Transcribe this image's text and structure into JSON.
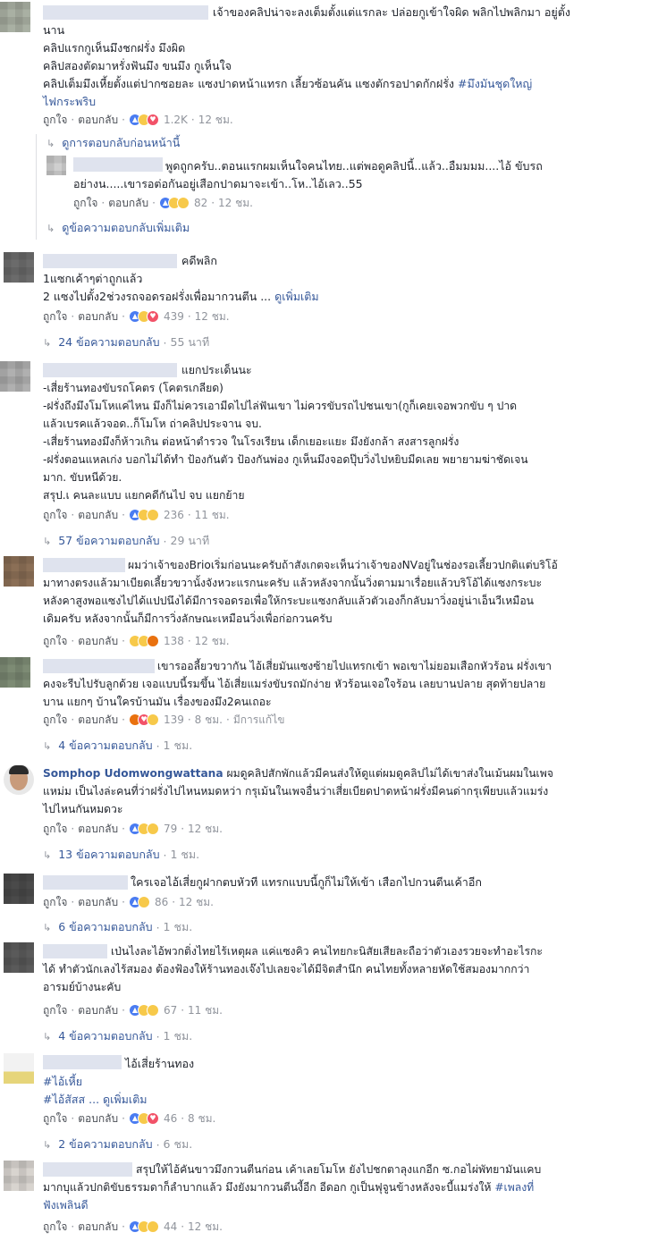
{
  "ui": {
    "like": "ถูกใจ",
    "reply": "ตอบกลับ",
    "dot": "·",
    "see_more": "ดูเพิ่มเติม",
    "prev_replies": "ดูการตอบกลับก่อนหน้านี้",
    "more_replies": "ดูข้อความตอบกลับเพิ่มเติม",
    "edited": "มีการแก้ไข"
  },
  "comments": [
    {
      "name": "",
      "lines": [
        "เจ้าของคลิปน่าจะลงเต็มตั้งแต่แรกละ ปล่อยกูเข้าใจผิด พลิกไปพลิกมา อยู่ตั้ง",
        "นาน",
        "คลิปแรกกูเห็นมึงชกฝรั่ง มึงผิด",
        "คลิปสองตัดมาหรั่งฟันมึง ขนมึง กูเห็นใจ",
        "คลิปเต็มมึงเหี้ยตั้งแต่ปากซอยละ แซงปาดหน้าแทรก เลี้ยวซ้อนคัน แซงตักรอปาดกักฝรั่ง",
        "ไฟกระพริบ"
      ],
      "hashtag": "#มึงมันชุดใหญ่",
      "reactions": "1.2K",
      "time": "12 ชม.",
      "replies_label": ""
    },
    {
      "name": "",
      "lines": [
        "พูดถูกครับ..ตอนแรกผมเห็นใจคนไทย..แต่พอดูคลิปนี้..แล้ว..อืมมมม....ไอ้ ขับรถ",
        "อย่างน.....เขารอต่อกันอยู่เสือกปาดมาจะเข้า..โห..ไอ้เลว..55"
      ],
      "reactions": "82",
      "time": "12 ชม."
    },
    {
      "name": "คดีพลิก",
      "lines": [
        "1แซกเค้าๆต่าถูกแล้ว",
        "2 แซงไปตั้ง2ช่วงรถจอดรอฝรั่งเพื่อมากวนตีน ..."
      ],
      "reactions": "439",
      "time": "12 ชม.",
      "replies_label": "24 ข้อความตอบกลับ",
      "replies_time": "55 นาที"
    },
    {
      "name": "แยกประเด็นนะ",
      "lines": [
        "-เสี่ยร้านทองขับรถโคตร (โคตรเกลียด)",
        "-ฝรั่งถึงมึงโมโหแค่ไหน มึงก็ไม่ควรเอามีดไปไล่ฟันเขา ไม่ควรขับรถไปชนเขา(กูก็เคยเจอพวกขับ ๆ ปาด",
        "แล้วเบรคแล้วจอด..ก็โมโห ถ่าคลิปประจาน จบ.",
        "-เสี่ยร้านทองมึงก็ห้าวเกิน ต่อหน้าตำรวจ ในโรงเรียน เด็กเยอะแยะ มึงยังกล้า สงสารลูกฝรั่ง",
        "-ฝรั่งตอนแหลเก่ง บอกไม่ได้ทำ ป้องกันตัว ป้องกันพ่อง กูเห็นมึงจอดปุ๊บวิ่งไปหยิบมีดเลย พยายามฆ่าชัดเจน",
        "มาก. ขับหนีด้วย.",
        "สรุป.เ คนละแบบ แยกคดีกันไป จบ แยกย้าย"
      ],
      "reactions": "236",
      "time": "11 ชม.",
      "replies_label": "57 ข้อความตอบกลับ",
      "replies_time": "29 นาที"
    },
    {
      "name": "",
      "lines": [
        "ผมว่าเจ้าของBrioเริ่มก่อนนะครับถ้าสังเกตจะเห็นว่าเจ้าของNVอยู่ในช่องรอเลี้ยวปกติแต่บริโอ้",
        "มาทางตรงแล้วมาเบียดเลี้ยวขวานั้งจังหวะแรกนะครับ แล้วหลังจากนั้นวิ่งตามมาเรื่อยแล้วบริโอ้ได้แซงกระบะ",
        "หลังคาสูงพอแซงไปได้แปปนึงได้มีการจอดรอเพื่อให้กระบะแซงกลับแล้วตัวเองก็กลับมาวิ่งอยู่น่าเอ็นวีเหมือน",
        "เดิมครับ หลังจากนั้นก็มีการวิ่งลักษณะเหมือนวิ่งเพื่อก่อกวนครับ"
      ],
      "reactions": "138",
      "time": "12 ชม."
    },
    {
      "name": "",
      "lines": [
        "เขารออลี้ยวขวากัน ไอ้เสี่ยมันแซงซ้ายไปแทรกเข้า พอเขาไม่ยอมเสือกหัวร้อน ฝรั่งเขา",
        "คงจะรีบไปรับลูกด้วย เจอแบบนี้รมขึ้น ไอ้เสี่ยแมร่งขับรถมักง่าย หัวร้อนเจอใจร้อน เลยบานปลาย สุดท้ายปลาย",
        "บาน แยกๆ บ้านใครบ้านมัน เรื่องของมึง2คนเถอะ"
      ],
      "reactions": "139",
      "time": "8 ชม.",
      "replies_label": "4 ข้อความตอบกลับ",
      "replies_time": "1 ชม."
    },
    {
      "name": "Somphop Udomwongwattana",
      "lines": [
        "ผมดูคลิปสักพักแล้วมีคนส่งให้ดูแต่ผมดูคลิปไม่ได้เขาส่งในเม้นผมในเพจ",
        "แหม่ม เป็นไงล่ะคนที่ว่าฝรั่งไปไหนหมดหว่า กรุเม้นในเพจอื่นว่าเสี่ยเบียดปาดหน้าฝรั่งมีคนด่ากรุเพียบแล้วแมร่ง",
        "ไปไหนกันหมดวะ"
      ],
      "reactions": "79",
      "time": "12 ชม.",
      "replies_label": "13 ข้อความตอบกลับ",
      "replies_time": "1 ชม."
    },
    {
      "name": "",
      "lines": [
        "ใครเจอไอ้เสี่ยกูฝากตบหัวที แทรกแบบนี้กูก็ไม่ให้เข้า เสือกไปกวนตีนเค้าอีก"
      ],
      "reactions": "86",
      "time": "12 ชม.",
      "replies_label": "6 ข้อความตอบกลับ",
      "replies_time": "1 ชม."
    },
    {
      "name": "",
      "lines": [
        "เป่นไงละไอ้พวกติ่งไทยไร้เหตุผล แค่แซงคิว คนไทยกะนิสัยเสียละถือว่าตัวเองรวยจะทำอะไรกะ",
        "ได้ ทำตัวนักเลงไร้สมอง ต้องฟ้องให้ร้านทองเจ๊งไปเลยจะได้มีจิตสำนึก คนไทยทั้งหลายหัดใช้สมองมากกว่า",
        "อารมย์บ้างนะคับ"
      ],
      "reactions": "67",
      "time": "11 ชม.",
      "replies_label": "4 ข้อความตอบกลับ",
      "replies_time": "1 ชม."
    },
    {
      "name": "ไอ้เสี่ยร้านทอง",
      "lines": [
        "#ไอ้เหี้ย",
        "#ไอ้สัสส ..."
      ],
      "reactions": "46",
      "time": "8 ชม.",
      "replies_label": "2 ข้อความตอบกลับ",
      "replies_time": "6 ชม."
    },
    {
      "name": "",
      "lines": [
        "สรุปให้ไอ้คันขาวมึงกวนตีนก่อน เค้าเลยโมโห ยังไปชกตาลุงแกอีก ซ.กอไผ่พัทยามันแคบ",
        "มากบุแล้วปกติขับธรรมดาก็ลำบากแล้ว มึงยังมากวนตีนงี้อีก อีดอก กูเป็นฟุจูนข้างหลังจะบี้แมร่งให้",
        "ฟังเพลินดี"
      ],
      "hashtag": "#เพลงที่",
      "reactions": "44",
      "time": "12 ชม."
    }
  ]
}
